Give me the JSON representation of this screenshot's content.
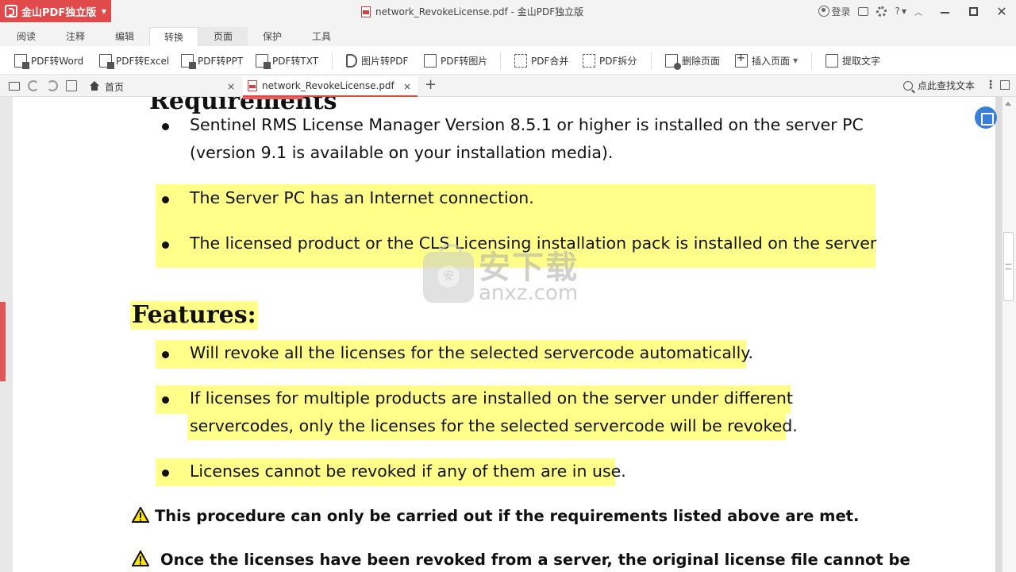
{
  "app": {
    "name": "金山PDF独立版",
    "window_title": "network_RevokeLicense.pdf - 金山PDF独立版",
    "login": "登录",
    "help": "?"
  },
  "menu_tabs": [
    "阅读",
    "注释",
    "编辑",
    "转换",
    "页面",
    "保护",
    "工具"
  ],
  "active_menu_tab": "转换",
  "ribbon": [
    {
      "label": "PDF转Word",
      "icon": "word-convert-icon"
    },
    {
      "label": "PDF转Excel",
      "icon": "excel-convert-icon"
    },
    {
      "label": "PDF转PPT",
      "icon": "ppt-convert-icon"
    },
    {
      "label": "PDF转TXT",
      "icon": "txt-convert-icon"
    },
    {
      "label": "图片转PDF",
      "icon": "image-to-pdf-icon"
    },
    {
      "label": "PDF转图片",
      "icon": "pdf-to-image-icon"
    },
    {
      "label": "PDF合并",
      "icon": "merge-icon"
    },
    {
      "label": "PDF拆分",
      "icon": "split-icon"
    },
    {
      "label": "删除页面",
      "icon": "delete-page-icon"
    },
    {
      "label": "插入页面",
      "icon": "insert-page-icon"
    },
    {
      "label": "提取文字",
      "icon": "extract-text-icon"
    }
  ],
  "tabs": {
    "home": "首页",
    "file": "network_RevokeLicense.pdf",
    "close": "×",
    "new": "+"
  },
  "search": {
    "label": "点此查找文本"
  },
  "document": {
    "req_bullets": [
      [
        "Sentinel RMS License Manager Version 8.5.1 or higher is installed on the server PC",
        "(version 9.1 is available on your installation media)."
      ],
      [
        "The Server PC has an Internet connection."
      ],
      [
        "The licensed product or the CLS Licensing installation pack is installed on the server"
      ]
    ],
    "features_heading": "Features:",
    "feature_bullets": [
      [
        "Will revoke all the licenses for the selected servercode automatically."
      ],
      [
        "If licenses for multiple products are installed on the server under different",
        "servercodes, only the licenses for the selected servercode will be revoked."
      ],
      [
        "Licenses cannot be revoked if any of them are in use."
      ]
    ],
    "warnings": [
      "This procedure can only be carried out if the requirements listed above are met.",
      "Once the licenses have been revoked from a server, the original license file cannot be"
    ]
  },
  "watermark": {
    "cn": "安下载",
    "en": "anxz.com"
  },
  "colors": {
    "accent": "#e14a4a",
    "highlight": "#ffff8a",
    "float_button": "#3a7fd5"
  }
}
